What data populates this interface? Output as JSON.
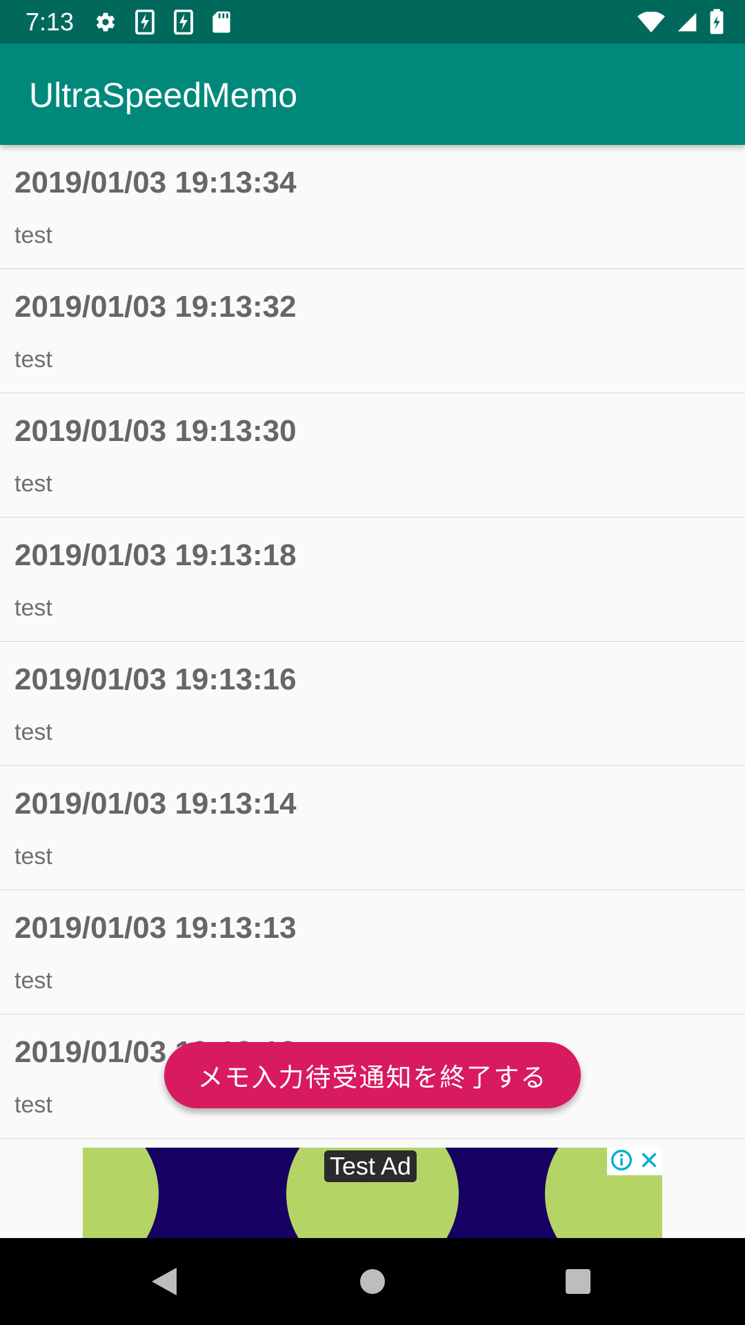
{
  "status_bar": {
    "time": "7:13",
    "left_icons": [
      "gear-icon",
      "flash-card-icon",
      "flash-card-icon",
      "sd-card-icon"
    ],
    "right_icons": [
      "wifi-icon",
      "signal-icon",
      "battery-charging-icon"
    ]
  },
  "app_bar": {
    "title": "UltraSpeedMemo"
  },
  "memos": [
    {
      "date": "2019/01/03 19:13:34",
      "text": "test"
    },
    {
      "date": "2019/01/03 19:13:32",
      "text": "test"
    },
    {
      "date": "2019/01/03 19:13:30",
      "text": "test"
    },
    {
      "date": "2019/01/03 19:13:18",
      "text": "test"
    },
    {
      "date": "2019/01/03 19:13:16",
      "text": "test"
    },
    {
      "date": "2019/01/03 19:13:14",
      "text": "test"
    },
    {
      "date": "2019/01/03 19:13:13",
      "text": "test"
    },
    {
      "date": "2019/01/03 19:13:12",
      "text": "test"
    }
  ],
  "floating_button": {
    "label": "メモ入力待受通知を終了する"
  },
  "ad": {
    "label": "Test Ad"
  },
  "nav": {
    "buttons": [
      "back-icon",
      "home-icon",
      "recents-icon"
    ]
  },
  "colors": {
    "status_bar": "#00695c",
    "app_bar": "#00897b",
    "accent": "#d81b60"
  }
}
